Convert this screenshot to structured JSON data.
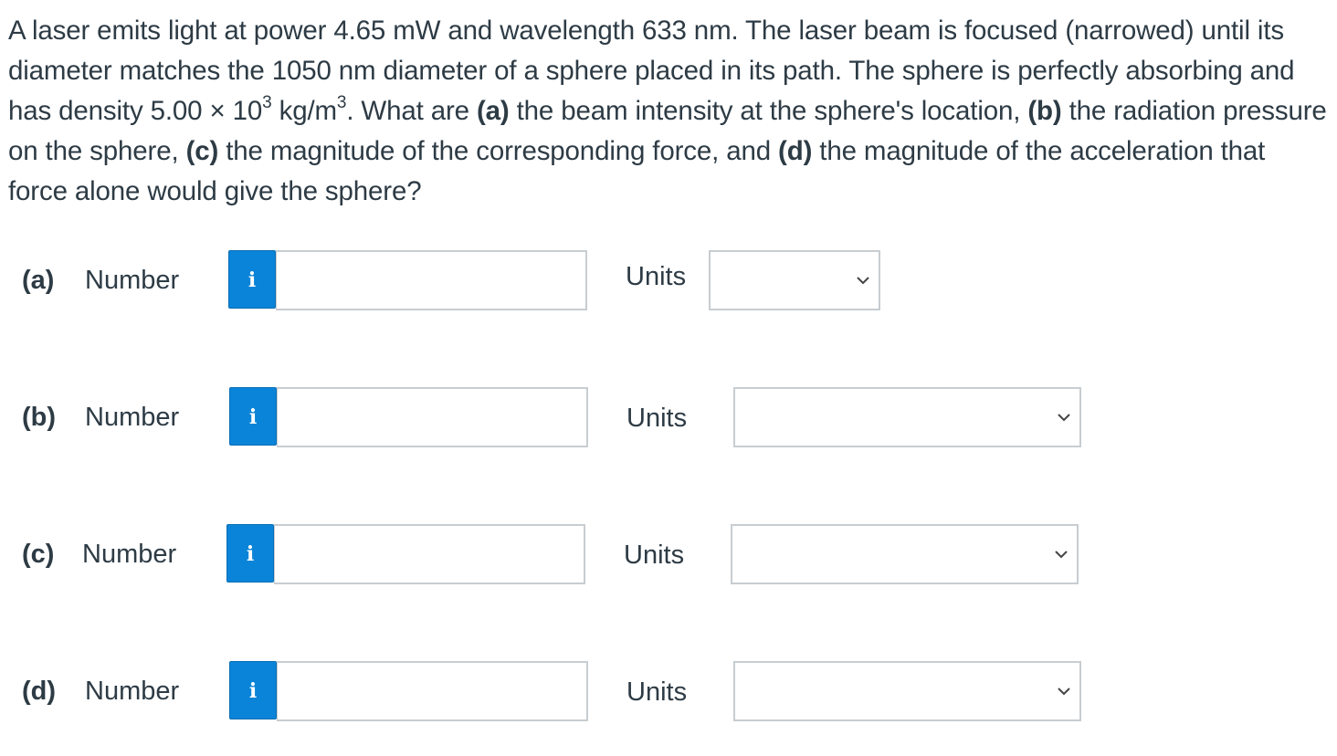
{
  "question": {
    "segments": [
      {
        "text": "A laser emits light at power 4.65 mW and wavelength 633 nm. The laser beam is focused (narrowed) until its diameter matches the 1050 nm diameter of a sphere placed in its path. The sphere is perfectly absorbing and has density 5.00 × 10",
        "style": "normal"
      },
      {
        "text": "3",
        "style": "sup"
      },
      {
        "text": " kg/m",
        "style": "normal"
      },
      {
        "text": "3",
        "style": "sup"
      },
      {
        "text": ". What are ",
        "style": "normal"
      },
      {
        "text": "(a)",
        "style": "bold"
      },
      {
        "text": " the beam intensity at the sphere's location, ",
        "style": "normal"
      },
      {
        "text": "(b)",
        "style": "bold"
      },
      {
        "text": " the radiation pressure on the sphere, ",
        "style": "normal"
      },
      {
        "text": "(c)",
        "style": "bold"
      },
      {
        "text": " the magnitude of the corresponding force, and ",
        "style": "normal"
      },
      {
        "text": "(d)",
        "style": "bold"
      },
      {
        "text": " the magnitude of the acceleration that force alone would give the sphere?",
        "style": "normal"
      }
    ]
  },
  "parts": [
    {
      "label": "(a)",
      "number_label": "Number",
      "info_icon": "i",
      "value": "",
      "units_label": "Units",
      "units_value": ""
    },
    {
      "label": "(b)",
      "number_label": "Number",
      "info_icon": "i",
      "value": "",
      "units_label": "Units",
      "units_value": ""
    },
    {
      "label": "(c)",
      "number_label": "Number",
      "info_icon": "i",
      "value": "",
      "units_label": "Units",
      "units_value": ""
    },
    {
      "label": "(d)",
      "number_label": "Number",
      "info_icon": "i",
      "value": "",
      "units_label": "Units",
      "units_value": ""
    }
  ],
  "colors": {
    "info_button": "#0a84d8",
    "text": "#2d3b45",
    "input_border": "#c7cdd1"
  }
}
